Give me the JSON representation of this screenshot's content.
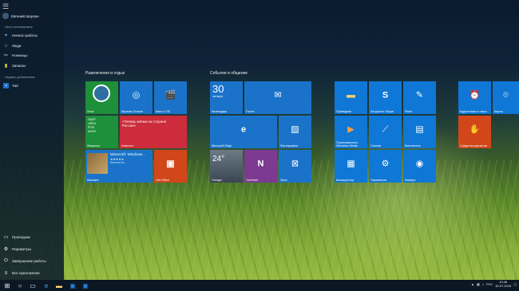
{
  "start_menu": {
    "user": "Евгений Шаулин",
    "most_used_heading": "Часто используемые",
    "most_used": [
      "Начало работы",
      "Люди",
      "Ножницы",
      "Записки"
    ],
    "recent_heading": "Недавно добавленные",
    "recent": [
      "Yad"
    ],
    "bottom": [
      "Проводник",
      "Параметры",
      "Завершение работы",
      "Все приложения"
    ]
  },
  "groups": [
    {
      "title": "Развлечения и отдых"
    },
    {
      "title": "События и общение"
    }
  ],
  "tiles": {
    "xbox": "Xbox",
    "groove": "Музыка Groove",
    "movies": "Кино и ТВ",
    "money_lines": [
      "GAZP",
      "URKA",
      "RTSI",
      "MGNT"
    ],
    "money": "Финансы",
    "news": "«Теперь мячик на стороне России»",
    "news_label": "Новости",
    "store_title": "Minecraft: Windows...",
    "store_rating": "★★★★★",
    "store_price": "Бесплатно",
    "store": "Магазин",
    "get_office": "Get Office",
    "cal_day": "30",
    "cal_weekday": "четверг",
    "calendar": "Календарь",
    "mail": "Почта",
    "edge": "Microsoft Edge",
    "photos": "Фотографии",
    "weather_temp": "24°",
    "weather": "Погода",
    "onenote": "OneNote",
    "xbox2": "Xbox",
    "explorer": "Проводник",
    "skype": "Загрузить Skype",
    "paint": "Paint",
    "wmp": "Проигрыватель Windows Media",
    "scanner": "Сканер",
    "news2": "Бюллетень",
    "calc": "Калькулятор",
    "settings": "Параметры",
    "camera": "Камера",
    "alarms": "Будильники и часы",
    "cards": "Карты",
    "ps": "Средство расчетов"
  },
  "taskbar": {
    "time": "10:46",
    "date": "30.07.2015",
    "lang": "РУС"
  }
}
